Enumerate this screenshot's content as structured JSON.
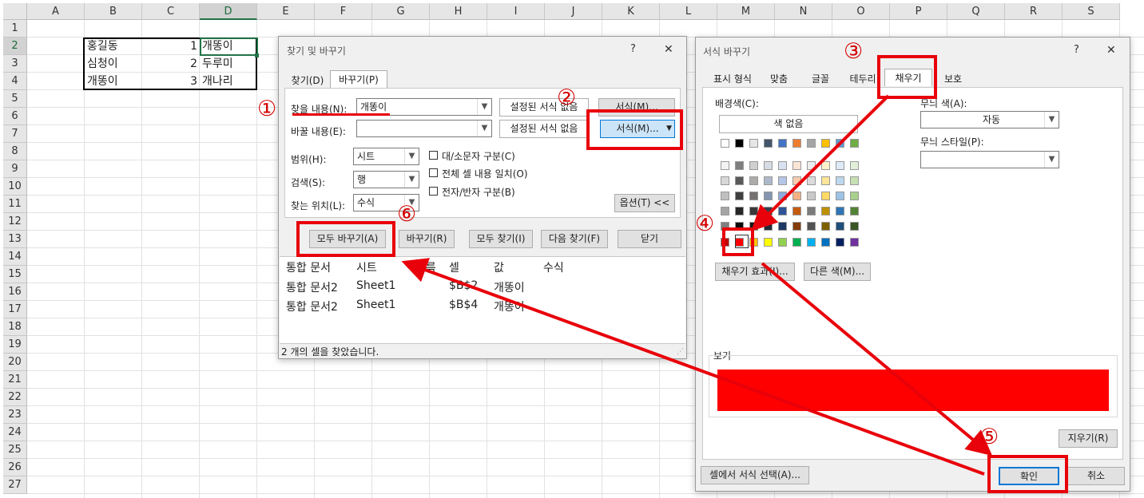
{
  "sheet": {
    "columns": [
      "A",
      "B",
      "C",
      "D",
      "E",
      "F",
      "G",
      "H",
      "I",
      "J",
      "K",
      "L",
      "M",
      "N",
      "O",
      "P",
      "Q",
      "R",
      "S"
    ],
    "rows": [
      "1",
      "2",
      "3",
      "4",
      "5",
      "6",
      "7",
      "8",
      "9",
      "10",
      "11",
      "12",
      "13",
      "14",
      "15",
      "16",
      "17",
      "18",
      "19",
      "20",
      "21",
      "22",
      "23",
      "24",
      "25",
      "26",
      "27"
    ],
    "cells": [
      {
        "ref": "B2",
        "value": "홍길동"
      },
      {
        "ref": "C2",
        "value": "1"
      },
      {
        "ref": "D2",
        "value": "개똥이"
      },
      {
        "ref": "B3",
        "value": "심청이"
      },
      {
        "ref": "C3",
        "value": "2"
      },
      {
        "ref": "D3",
        "value": "두루미"
      },
      {
        "ref": "B4",
        "value": "개똥이"
      },
      {
        "ref": "C4",
        "value": "3"
      },
      {
        "ref": "D4",
        "value": "개나리"
      }
    ]
  },
  "find_dialog": {
    "title": "찾기 및 바꾸기",
    "help": "?",
    "close": "✕",
    "tabs": [
      "찾기(D)",
      "바꾸기(P)"
    ],
    "find_label": "찾을 내용(N):",
    "find_value": "개똥이",
    "replace_label": "바꿀 내용(E):",
    "replace_value": "",
    "preset_find": "설정된 서식 없음",
    "preset_replace": "설정된 서식 없음",
    "format_find": "서식(M)...",
    "format_replace": "서식(M)...",
    "scope_label": "범위(H):",
    "scope_value": "시트",
    "search_label": "검색(S):",
    "search_value": "행",
    "lookin_label": "찾는 위치(L):",
    "lookin_value": "수식",
    "match_case": "대/소문자 구분(C)",
    "match_entire": "전체 셀 내용 일치(O)",
    "match_width": "전자/반자 구분(B)",
    "options": "옵션(T) <<",
    "replace_all": "모두 바꾸기(A)",
    "replace": "바꾸기(R)",
    "find_all": "모두 찾기(I)",
    "find_next": "다음 찾기(F)",
    "close_button": "닫기",
    "results_headers": [
      "통합 문서",
      "시트",
      "이름",
      "셀",
      "값",
      "수식"
    ],
    "results": [
      {
        "book": "통합 문서2",
        "sheet": "Sheet1",
        "name": "",
        "cell": "$B$2",
        "value": "개똥이",
        "formula": ""
      },
      {
        "book": "통합 문서2",
        "sheet": "Sheet1",
        "name": "",
        "cell": "$B$4",
        "value": "개똥이",
        "formula": ""
      }
    ],
    "status": "2 개의 셀을 찾았습니다."
  },
  "format_dialog": {
    "title": "서식 바꾸기",
    "help": "?",
    "close": "✕",
    "tabs": [
      "표시 형식",
      "맞춤",
      "글꼴",
      "테두리",
      "채우기",
      "보호"
    ],
    "bg_label": "배경색(C):",
    "no_color": "색 없음",
    "pattern_color_label": "무늬 색(A):",
    "pattern_color_value": "자동",
    "pattern_style_label": "무늬 스타일(P):",
    "fill_effects": "채우기 효과(I)...",
    "more_colors": "다른 색(M)...",
    "preview_label": "보기",
    "preview_color": "#ff0000",
    "clear": "지우기(R)",
    "choose_from_cell": "셀에서 서식 선택(A)...",
    "ok": "확인",
    "cancel": "취소",
    "theme_row": [
      "#ffffff",
      "#000000",
      "#e7e6e6",
      "#44546a",
      "#4472c4",
      "#ed7d31",
      "#a5a5a5",
      "#ffc000",
      "#5b9bd5",
      "#70ad47"
    ],
    "shades": [
      [
        "#f2f2f2",
        "#7f7f7f",
        "#d0cece",
        "#d6dce4",
        "#d9e2f3",
        "#fbe5d5",
        "#ededed",
        "#fff2cc",
        "#deebf6",
        "#e2efd9"
      ],
      [
        "#d8d8d8",
        "#595959",
        "#aeabab",
        "#adb9ca",
        "#b4c6e7",
        "#f7cbac",
        "#dbdbdb",
        "#fee599",
        "#bdd7ee",
        "#c5e0b3"
      ],
      [
        "#bfbfbf",
        "#3f3f3f",
        "#757070",
        "#8496b0",
        "#8eaadb",
        "#f4b183",
        "#c9c9c9",
        "#ffd965",
        "#9dc3e6",
        "#a8d08d"
      ],
      [
        "#a5a5a5",
        "#262626",
        "#3a3838",
        "#323f4f",
        "#2f5496",
        "#c55a11",
        "#7b7b7b",
        "#bf9000",
        "#2e75b5",
        "#538135"
      ],
      [
        "#7f7f7f",
        "#0c0c0c",
        "#171616",
        "#222a35",
        "#1f3864",
        "#833c0b",
        "#525252",
        "#7f6000",
        "#1e4e79",
        "#375623"
      ]
    ],
    "standard_row": [
      "#c00000",
      "#ff0000",
      "#ffc000",
      "#ffff00",
      "#92d050",
      "#00b050",
      "#00b0f0",
      "#0070c0",
      "#002060",
      "#7030a0"
    ]
  },
  "annotations": [
    "①",
    "②",
    "③",
    "④",
    "⑤",
    "⑥"
  ]
}
